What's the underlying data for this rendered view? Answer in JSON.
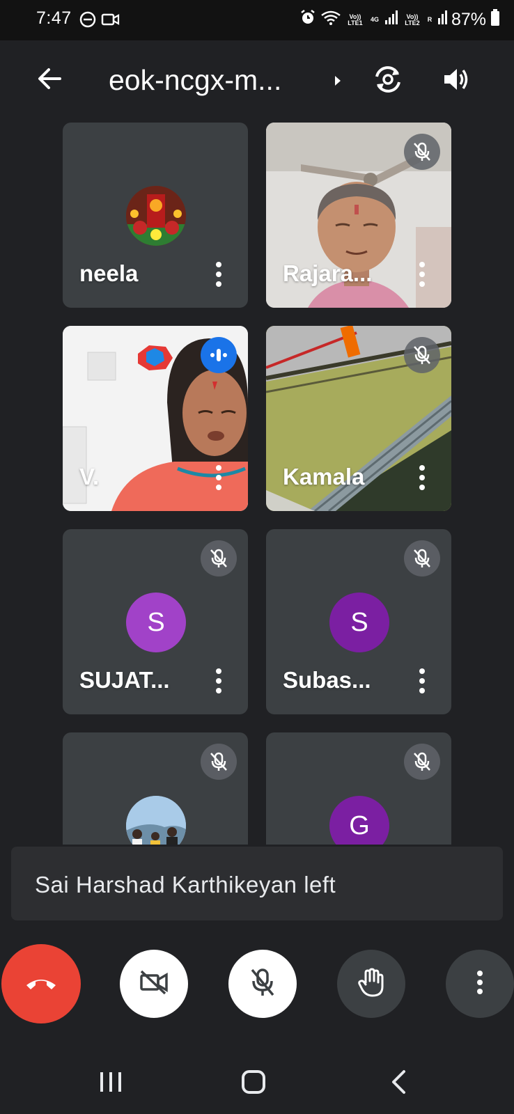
{
  "status_bar": {
    "time": "7:47",
    "network_1": "Vo)) LTE1",
    "network_type": "4G",
    "network_2": "Vo)) LTE2",
    "roaming": "R",
    "battery": "87%",
    "icons": [
      "do-not-disturb-icon",
      "video-recording-icon",
      "alarm-icon",
      "wifi-icon",
      "signal-icon",
      "battery-icon"
    ]
  },
  "header": {
    "meeting_code": "eok-ncgx-m...",
    "icons": [
      "back-arrow-icon",
      "caret-right-icon",
      "switch-camera-icon",
      "speaker-icon"
    ]
  },
  "participants": [
    {
      "name": "neela",
      "muted": false,
      "video": false,
      "avatar": "photo"
    },
    {
      "name": "Rajara...",
      "muted": true,
      "video": true
    },
    {
      "name": "V.",
      "muted": false,
      "video": true,
      "speaking": true
    },
    {
      "name": "Kamala",
      "muted": true,
      "video": true
    },
    {
      "name": "SUJAT...",
      "muted": true,
      "video": false,
      "initial": "S",
      "avatar_color": "#a142c8"
    },
    {
      "name": "Subas...",
      "muted": true,
      "video": false,
      "initial": "S",
      "avatar_color": "#7b1fa2"
    },
    {
      "name": "",
      "muted": true,
      "video": false,
      "avatar": "photo"
    },
    {
      "name": "",
      "muted": true,
      "video": false,
      "initial": "G",
      "avatar_color": "#7b1fa2"
    }
  ],
  "toast": {
    "message": "Sai Harshad Karthikeyan left"
  },
  "controls": {
    "icons": [
      "end-call-icon",
      "camera-off-icon",
      "mic-off-icon",
      "raise-hand-icon",
      "more-options-icon"
    ],
    "end_call_color": "#ea4335"
  },
  "nav_bar": {
    "icons": [
      "recent-apps-icon",
      "home-icon",
      "back-icon"
    ]
  }
}
